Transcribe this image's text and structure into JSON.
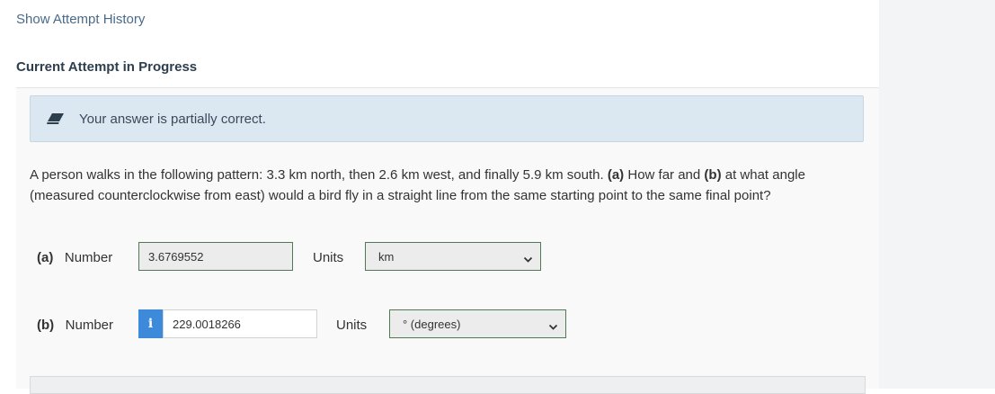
{
  "header": {
    "history_link": "Show Attempt History",
    "attempt_heading": "Current Attempt in Progress"
  },
  "feedback": {
    "icon": "eraser-icon",
    "message": "Your answer is partially correct."
  },
  "question": {
    "text_1": "A person walks in the following pattern: 3.3 km north, then 2.6 km west, and finally 5.9 km south. ",
    "part_a_marker": "(a)",
    "text_2": " How far and ",
    "part_b_marker": "(b)",
    "text_3": " at what angle (measured counterclockwise from east) would a bird fly in a straight line from the same starting point to the same final point?"
  },
  "parts": [
    {
      "marker": "(a)",
      "number_label": "Number",
      "value": "3.6769552",
      "units_label": "Units",
      "unit_selected": "km"
    },
    {
      "marker": "(b)",
      "number_label": "Number",
      "info_icon_glyph": "i",
      "value": "229.0018266",
      "units_label": "Units",
      "unit_selected": "° (degrees)"
    }
  ],
  "colors": {
    "feedback_bg": "#dbe7f1",
    "graded_border": "#4f7a55",
    "info_blue": "#3c8ad9",
    "link": "#4a6a8a"
  }
}
